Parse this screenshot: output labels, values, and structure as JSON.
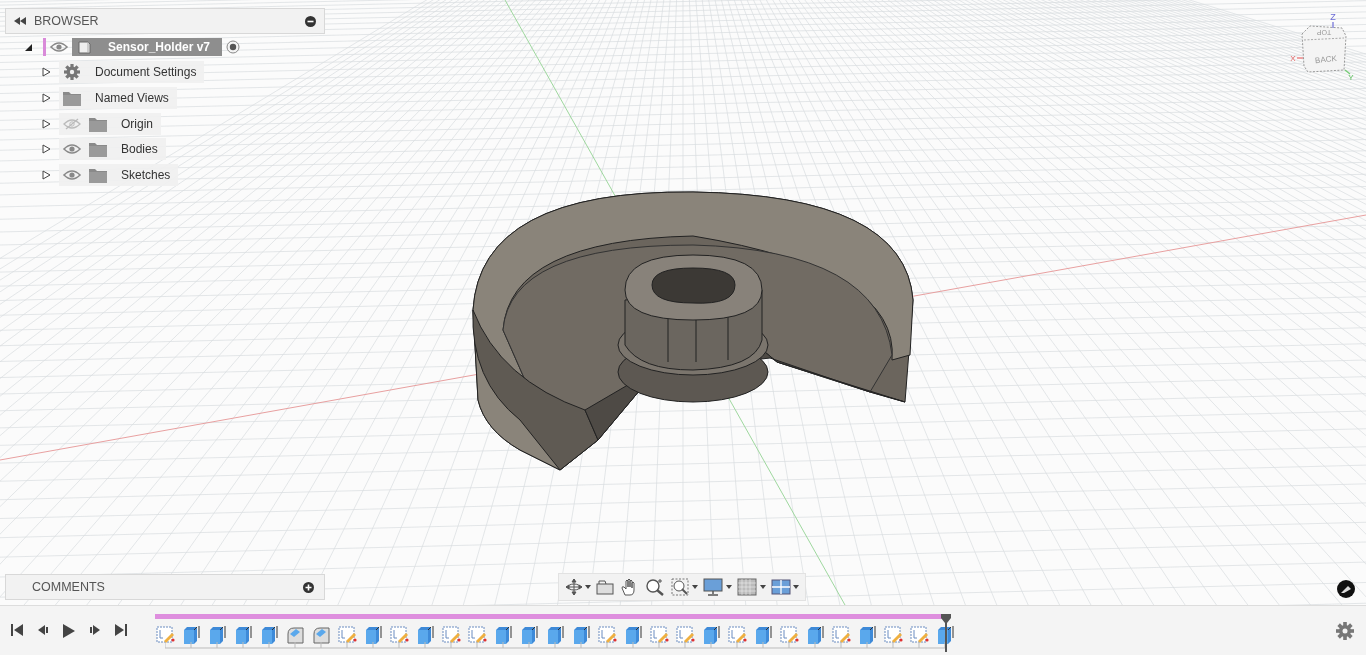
{
  "browser": {
    "title": "BROWSER",
    "root": {
      "label": "Sensor_Holder v7",
      "expanded": true,
      "visible": true,
      "active": true,
      "children": [
        {
          "label": "Document Settings",
          "kind": "settings",
          "expanded": false
        },
        {
          "label": "Named Views",
          "kind": "folder",
          "expanded": false
        },
        {
          "label": "Origin",
          "kind": "folder",
          "expanded": false,
          "visible": false
        },
        {
          "label": "Bodies",
          "kind": "folder",
          "expanded": false,
          "visible": true
        },
        {
          "label": "Sketches",
          "kind": "folder",
          "expanded": false,
          "visible": true
        }
      ]
    }
  },
  "view_cube": {
    "top_face": "TOP",
    "front_face": "BACK",
    "axis_z": "Z",
    "axis_x": "X",
    "axis_y": "Y"
  },
  "comments": {
    "title": "COMMENTS"
  },
  "timeline": {
    "features": [
      {
        "kind": "sketch"
      },
      {
        "kind": "extrude"
      },
      {
        "kind": "extrude"
      },
      {
        "kind": "extrude"
      },
      {
        "kind": "extrude"
      },
      {
        "kind": "fillet"
      },
      {
        "kind": "fillet"
      },
      {
        "kind": "sketch"
      },
      {
        "kind": "extrude"
      },
      {
        "kind": "sketch"
      },
      {
        "kind": "extrude"
      },
      {
        "kind": "sketch"
      },
      {
        "kind": "sketch"
      },
      {
        "kind": "extrude"
      },
      {
        "kind": "extrude"
      },
      {
        "kind": "extrude"
      },
      {
        "kind": "extrude"
      },
      {
        "kind": "sketch"
      },
      {
        "kind": "extrude"
      },
      {
        "kind": "sketch"
      },
      {
        "kind": "sketch"
      },
      {
        "kind": "extrude"
      },
      {
        "kind": "sketch"
      },
      {
        "kind": "extrude"
      },
      {
        "kind": "sketch"
      },
      {
        "kind": "extrude"
      },
      {
        "kind": "sketch"
      },
      {
        "kind": "extrude"
      },
      {
        "kind": "sketch"
      },
      {
        "kind": "sketch"
      },
      {
        "kind": "extrude"
      }
    ]
  }
}
